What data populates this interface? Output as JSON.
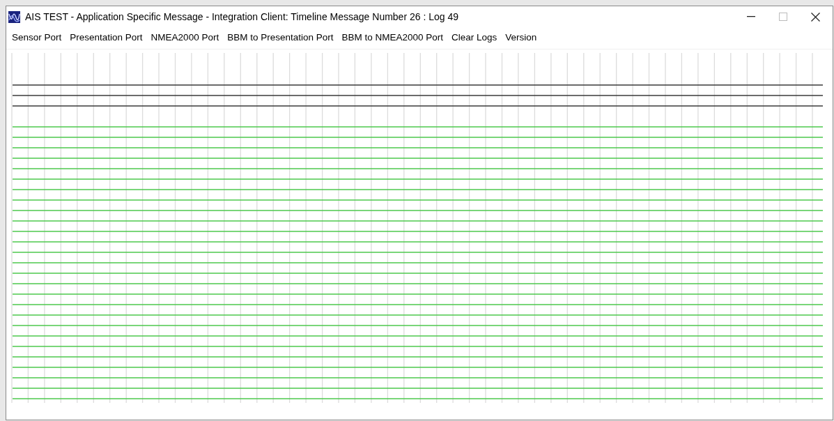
{
  "window": {
    "title": "AIS TEST - Application Specific Message - Integration Client: Timeline Message Number 26 : Log 49"
  },
  "menu": [
    {
      "label": "Sensor Port"
    },
    {
      "label": "Presentation Port"
    },
    {
      "label": "NMEA2000 Port"
    },
    {
      "label": "BBM to Presentation Port"
    },
    {
      "label": "BBM to NMEA2000 Port"
    },
    {
      "label": "Clear Logs"
    },
    {
      "label": "Version"
    }
  ]
}
